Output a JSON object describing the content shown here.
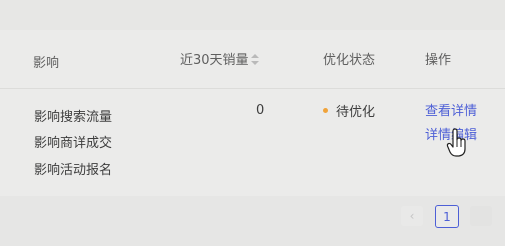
{
  "table": {
    "headers": {
      "impact": "影响",
      "sales": "近30天销量",
      "status": "优化状态",
      "ops": "操作"
    },
    "row": {
      "impacts": [
        "影响搜索流量",
        "影响商详成交",
        "影响活动报名"
      ],
      "sales": "0",
      "status": "待优化",
      "status_color": "#f0a33a",
      "actions": {
        "view": "查看详情",
        "edit": "详情编辑"
      }
    }
  },
  "pagination": {
    "current": "1"
  },
  "colors": {
    "link": "#4d5fd6",
    "status_pending": "#f0a33a"
  },
  "icons": {
    "sort": "sort-icon",
    "cursor": "hand-pointer-icon",
    "prev": "chevron-left-icon"
  }
}
